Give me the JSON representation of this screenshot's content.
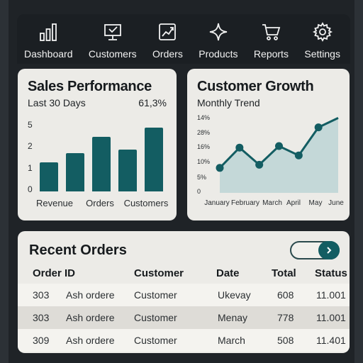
{
  "nav": {
    "items": [
      {
        "label": "Dashboard",
        "icon": "bar-chart-icon"
      },
      {
        "label": "Customers",
        "icon": "monitor-icon"
      },
      {
        "label": "Orders",
        "icon": "trend-chart-icon"
      },
      {
        "label": "Products",
        "icon": "sparkle-icon"
      },
      {
        "label": "Reports",
        "icon": "cart-icon"
      },
      {
        "label": "Settings",
        "icon": "gear-icon"
      }
    ]
  },
  "sales": {
    "title": "Sales Performance",
    "subtitle": "Last 30 Days",
    "stat": "61,3%"
  },
  "growth": {
    "title": "Customer Growth",
    "subtitle": "Monthly Trend"
  },
  "orders": {
    "title": "Recent Orders",
    "columns": [
      "Order ID",
      "",
      "Customer",
      "Date",
      "Total",
      "Status"
    ],
    "rows": [
      [
        "303",
        "Ash ordere",
        "Customer",
        "Ukevay",
        "608",
        "11.001"
      ],
      [
        "303",
        "Ash ordere",
        "Customer",
        "Menay",
        "778",
        "11.001"
      ],
      [
        "309",
        "Ash ordere",
        "Customer",
        "March",
        "508",
        "11.401"
      ]
    ]
  },
  "colors": {
    "accent": "#135d62",
    "area_fill": "#c4d8d8",
    "card_bg": "#ecebe7",
    "nav_bg": "#1b1f23"
  },
  "chart_data": [
    {
      "type": "bar",
      "categories": [
        "",
        "Revenue",
        "",
        "Orders",
        "",
        "Customers"
      ],
      "values": [
        1.6,
        2.1,
        3.0,
        2.3,
        3.5
      ],
      "yticks": [
        "5",
        "2",
        "1",
        "0"
      ],
      "xticks": [
        "Revenue",
        "Orders",
        "Customers"
      ],
      "grid": false
    },
    {
      "type": "area",
      "x": [
        "January",
        "February",
        "March",
        "April",
        "May",
        "June"
      ],
      "values": [
        8,
        14.5,
        9,
        15,
        12,
        21,
        24
      ],
      "yticks": [
        "14%",
        "28%",
        "16%",
        "10%",
        "5%",
        "0"
      ],
      "ylim": [
        0,
        25
      ],
      "grid": false
    }
  ]
}
